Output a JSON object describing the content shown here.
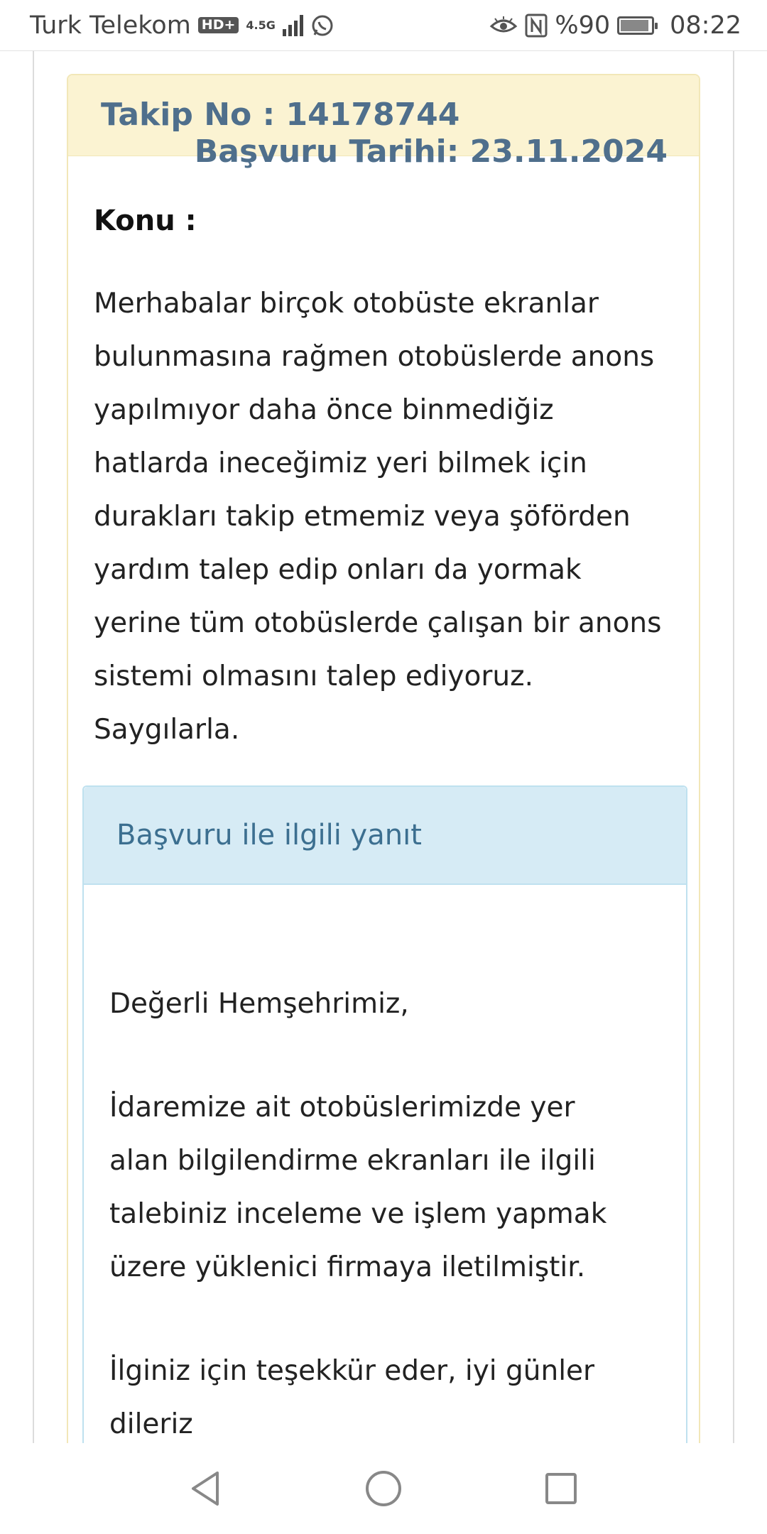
{
  "status_bar": {
    "carrier": "Turk Telekom",
    "hd": "HD+",
    "network": "4.5G",
    "battery": "%90",
    "time": "08:22"
  },
  "application": {
    "tracking_label": "Takip No : 14178744",
    "date_label": "Başvuru Tarihi: 23.11.2024",
    "subject_label": "Konu :",
    "subject_text": "Merhabalar birçok otobüste ekranlar bulunmasına rağmen otobüslerde anons yapılmıyor daha önce binmediğiz hatlarda ineceğimiz yeri bilmek için durakları takip etmemiz veya şöförden yardım talep edip onları da yormak yerine tüm otobüslerde çalışan bir anons sistemi olmasını talep ediyoruz. Saygılarla."
  },
  "reply": {
    "title": "Başvuru ile ilgili yanıt",
    "greeting": "Değerli Hemşehrimiz,",
    "body": "İdaremize ait otobüslerimizde yer alan bilgilendirme ekranları ile ilgili talebiniz inceleme ve işlem yapmak üzere yüklenici firmaya iletilmiştir.",
    "closing": "İlginiz için teşekkür eder, iyi günler dileriz"
  },
  "nav": {
    "back_icon": "back-triangle-icon",
    "home_icon": "home-circle-icon",
    "recents_icon": "recents-square-icon"
  }
}
